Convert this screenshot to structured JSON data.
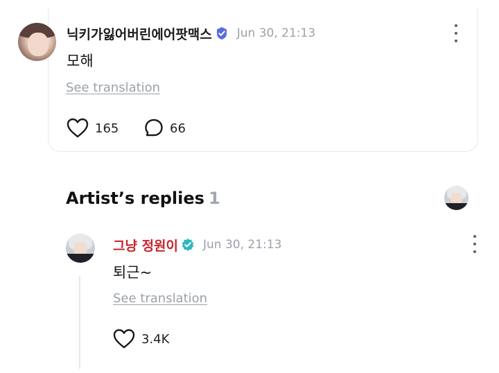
{
  "fan_comment": {
    "author": "닉키가잃어버린에어팟맥스",
    "timestamp": "Jun 30, 21:13",
    "body": "모해",
    "see_translation": "See translation",
    "likes": "165",
    "replies": "66",
    "badge_color": "#5b6be0"
  },
  "artist_replies": {
    "title": "Artist’s replies",
    "count": "1",
    "reply": {
      "author": "그냥 정원이",
      "timestamp": "Jun 30, 21:13",
      "body": "퇴근~",
      "see_translation": "See translation",
      "likes": "3.4K",
      "author_color": "#c8242b",
      "badge_color": "#2fb6c2"
    }
  },
  "icons": {
    "more": "more-vertical-icon",
    "like": "heart-outline-icon",
    "reply": "speech-bubble-icon",
    "verified": "verified-badge-icon"
  }
}
